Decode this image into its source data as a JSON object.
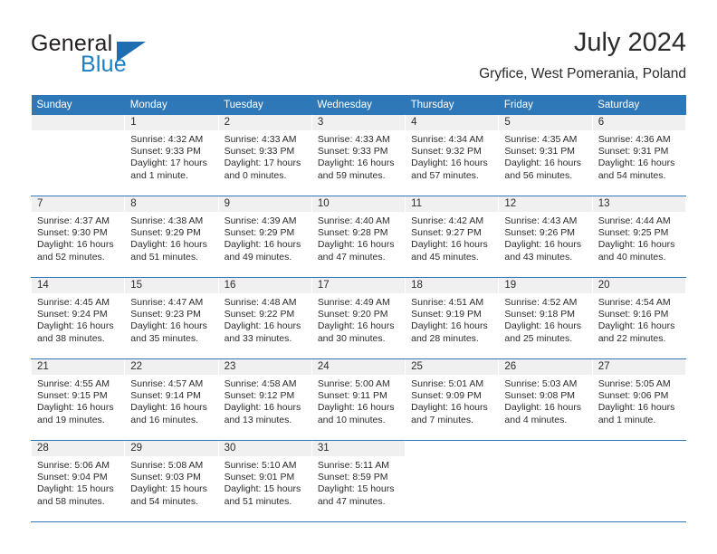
{
  "brand": {
    "word_general": "General",
    "word_blue": "Blue",
    "triangle_color": "#1f6cb0",
    "blue_color": "#1b7fc4"
  },
  "header": {
    "title": "July 2024",
    "location": "Gryfice, West Pomerania, Poland"
  },
  "theme": {
    "header_blue": "#2e78b8",
    "daynum_band": "#f0f0f0",
    "text": "#2b2b2b"
  },
  "weekday_headers": [
    "Sunday",
    "Monday",
    "Tuesday",
    "Wednesday",
    "Thursday",
    "Friday",
    "Saturday"
  ],
  "weeks": [
    [
      {
        "day": "",
        "sunrise": "",
        "sunset": "",
        "daylight1": "",
        "daylight2": "",
        "blank": true,
        "trailing": false
      },
      {
        "day": "1",
        "sunrise": "Sunrise: 4:32 AM",
        "sunset": "Sunset: 9:33 PM",
        "daylight1": "Daylight: 17 hours",
        "daylight2": "and 1 minute."
      },
      {
        "day": "2",
        "sunrise": "Sunrise: 4:33 AM",
        "sunset": "Sunset: 9:33 PM",
        "daylight1": "Daylight: 17 hours",
        "daylight2": "and 0 minutes."
      },
      {
        "day": "3",
        "sunrise": "Sunrise: 4:33 AM",
        "sunset": "Sunset: 9:33 PM",
        "daylight1": "Daylight: 16 hours",
        "daylight2": "and 59 minutes."
      },
      {
        "day": "4",
        "sunrise": "Sunrise: 4:34 AM",
        "sunset": "Sunset: 9:32 PM",
        "daylight1": "Daylight: 16 hours",
        "daylight2": "and 57 minutes."
      },
      {
        "day": "5",
        "sunrise": "Sunrise: 4:35 AM",
        "sunset": "Sunset: 9:31 PM",
        "daylight1": "Daylight: 16 hours",
        "daylight2": "and 56 minutes."
      },
      {
        "day": "6",
        "sunrise": "Sunrise: 4:36 AM",
        "sunset": "Sunset: 9:31 PM",
        "daylight1": "Daylight: 16 hours",
        "daylight2": "and 54 minutes."
      }
    ],
    [
      {
        "day": "7",
        "sunrise": "Sunrise: 4:37 AM",
        "sunset": "Sunset: 9:30 PM",
        "daylight1": "Daylight: 16 hours",
        "daylight2": "and 52 minutes."
      },
      {
        "day": "8",
        "sunrise": "Sunrise: 4:38 AM",
        "sunset": "Sunset: 9:29 PM",
        "daylight1": "Daylight: 16 hours",
        "daylight2": "and 51 minutes."
      },
      {
        "day": "9",
        "sunrise": "Sunrise: 4:39 AM",
        "sunset": "Sunset: 9:29 PM",
        "daylight1": "Daylight: 16 hours",
        "daylight2": "and 49 minutes."
      },
      {
        "day": "10",
        "sunrise": "Sunrise: 4:40 AM",
        "sunset": "Sunset: 9:28 PM",
        "daylight1": "Daylight: 16 hours",
        "daylight2": "and 47 minutes."
      },
      {
        "day": "11",
        "sunrise": "Sunrise: 4:42 AM",
        "sunset": "Sunset: 9:27 PM",
        "daylight1": "Daylight: 16 hours",
        "daylight2": "and 45 minutes."
      },
      {
        "day": "12",
        "sunrise": "Sunrise: 4:43 AM",
        "sunset": "Sunset: 9:26 PM",
        "daylight1": "Daylight: 16 hours",
        "daylight2": "and 43 minutes."
      },
      {
        "day": "13",
        "sunrise": "Sunrise: 4:44 AM",
        "sunset": "Sunset: 9:25 PM",
        "daylight1": "Daylight: 16 hours",
        "daylight2": "and 40 minutes."
      }
    ],
    [
      {
        "day": "14",
        "sunrise": "Sunrise: 4:45 AM",
        "sunset": "Sunset: 9:24 PM",
        "daylight1": "Daylight: 16 hours",
        "daylight2": "and 38 minutes."
      },
      {
        "day": "15",
        "sunrise": "Sunrise: 4:47 AM",
        "sunset": "Sunset: 9:23 PM",
        "daylight1": "Daylight: 16 hours",
        "daylight2": "and 35 minutes."
      },
      {
        "day": "16",
        "sunrise": "Sunrise: 4:48 AM",
        "sunset": "Sunset: 9:22 PM",
        "daylight1": "Daylight: 16 hours",
        "daylight2": "and 33 minutes."
      },
      {
        "day": "17",
        "sunrise": "Sunrise: 4:49 AM",
        "sunset": "Sunset: 9:20 PM",
        "daylight1": "Daylight: 16 hours",
        "daylight2": "and 30 minutes."
      },
      {
        "day": "18",
        "sunrise": "Sunrise: 4:51 AM",
        "sunset": "Sunset: 9:19 PM",
        "daylight1": "Daylight: 16 hours",
        "daylight2": "and 28 minutes."
      },
      {
        "day": "19",
        "sunrise": "Sunrise: 4:52 AM",
        "sunset": "Sunset: 9:18 PM",
        "daylight1": "Daylight: 16 hours",
        "daylight2": "and 25 minutes."
      },
      {
        "day": "20",
        "sunrise": "Sunrise: 4:54 AM",
        "sunset": "Sunset: 9:16 PM",
        "daylight1": "Daylight: 16 hours",
        "daylight2": "and 22 minutes."
      }
    ],
    [
      {
        "day": "21",
        "sunrise": "Sunrise: 4:55 AM",
        "sunset": "Sunset: 9:15 PM",
        "daylight1": "Daylight: 16 hours",
        "daylight2": "and 19 minutes."
      },
      {
        "day": "22",
        "sunrise": "Sunrise: 4:57 AM",
        "sunset": "Sunset: 9:14 PM",
        "daylight1": "Daylight: 16 hours",
        "daylight2": "and 16 minutes."
      },
      {
        "day": "23",
        "sunrise": "Sunrise: 4:58 AM",
        "sunset": "Sunset: 9:12 PM",
        "daylight1": "Daylight: 16 hours",
        "daylight2": "and 13 minutes."
      },
      {
        "day": "24",
        "sunrise": "Sunrise: 5:00 AM",
        "sunset": "Sunset: 9:11 PM",
        "daylight1": "Daylight: 16 hours",
        "daylight2": "and 10 minutes."
      },
      {
        "day": "25",
        "sunrise": "Sunrise: 5:01 AM",
        "sunset": "Sunset: 9:09 PM",
        "daylight1": "Daylight: 16 hours",
        "daylight2": "and 7 minutes."
      },
      {
        "day": "26",
        "sunrise": "Sunrise: 5:03 AM",
        "sunset": "Sunset: 9:08 PM",
        "daylight1": "Daylight: 16 hours",
        "daylight2": "and 4 minutes."
      },
      {
        "day": "27",
        "sunrise": "Sunrise: 5:05 AM",
        "sunset": "Sunset: 9:06 PM",
        "daylight1": "Daylight: 16 hours",
        "daylight2": "and 1 minute."
      }
    ],
    [
      {
        "day": "28",
        "sunrise": "Sunrise: 5:06 AM",
        "sunset": "Sunset: 9:04 PM",
        "daylight1": "Daylight: 15 hours",
        "daylight2": "and 58 minutes."
      },
      {
        "day": "29",
        "sunrise": "Sunrise: 5:08 AM",
        "sunset": "Sunset: 9:03 PM",
        "daylight1": "Daylight: 15 hours",
        "daylight2": "and 54 minutes."
      },
      {
        "day": "30",
        "sunrise": "Sunrise: 5:10 AM",
        "sunset": "Sunset: 9:01 PM",
        "daylight1": "Daylight: 15 hours",
        "daylight2": "and 51 minutes."
      },
      {
        "day": "31",
        "sunrise": "Sunrise: 5:11 AM",
        "sunset": "Sunset: 8:59 PM",
        "daylight1": "Daylight: 15 hours",
        "daylight2": "and 47 minutes."
      },
      {
        "day": "",
        "sunrise": "",
        "sunset": "",
        "daylight1": "",
        "daylight2": "",
        "blank": true,
        "trailing": true
      },
      {
        "day": "",
        "sunrise": "",
        "sunset": "",
        "daylight1": "",
        "daylight2": "",
        "blank": true,
        "trailing": true
      },
      {
        "day": "",
        "sunrise": "",
        "sunset": "",
        "daylight1": "",
        "daylight2": "",
        "blank": true,
        "trailing": true
      }
    ]
  ]
}
